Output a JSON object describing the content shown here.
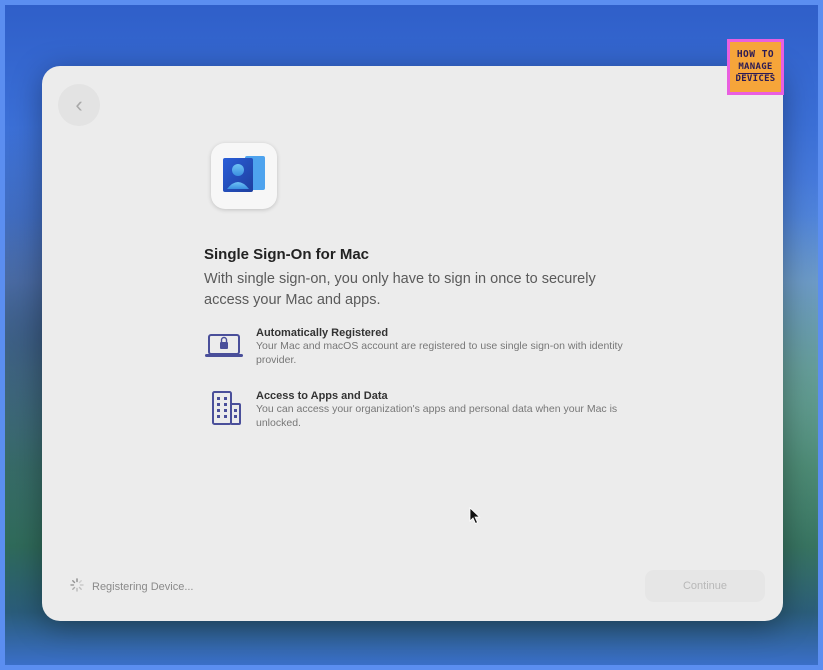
{
  "dialog": {
    "title": "Single Sign-On for Mac",
    "subtitle": "With single sign-on, you only have to sign in once to securely access your Mac and apps.",
    "features": [
      {
        "icon": "laptop-lock-icon",
        "title": "Automatically Registered",
        "description": "Your Mac and macOS account are registered to use single sign-on with identity provider."
      },
      {
        "icon": "building-icon",
        "title": "Access to Apps and Data",
        "description": "You can access your organization's apps and personal data when your Mac is unlocked."
      }
    ],
    "status_text": "Registering Device...",
    "continue_label": "Continue"
  },
  "watermark": {
    "line1": "HOW TO",
    "line2": "MANAGE",
    "line3": "DEVICES"
  },
  "colors": {
    "accent_blue": "#2f6fd8",
    "feature_icon": "#4a4f9a",
    "logo_pink": "#e95fe0",
    "logo_orange": "#f6a53a"
  }
}
